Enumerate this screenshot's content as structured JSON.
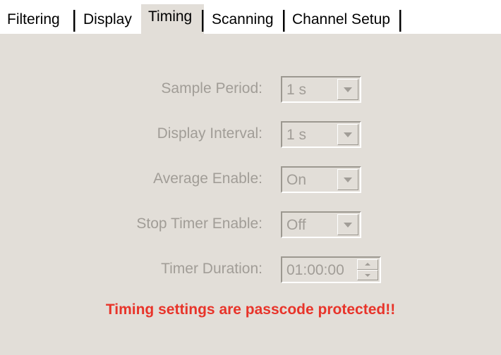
{
  "tabs": [
    {
      "label": "Filtering",
      "active": false
    },
    {
      "label": "Display",
      "active": false
    },
    {
      "label": "Timing",
      "active": true
    },
    {
      "label": "Scanning",
      "active": false
    },
    {
      "label": "Channel Setup",
      "active": false
    }
  ],
  "fields": {
    "sample_period": {
      "label": "Sample Period:",
      "value": "1 s",
      "enabled": false
    },
    "display_interval": {
      "label": "Display Interval:",
      "value": "1 s",
      "enabled": false
    },
    "average_enable": {
      "label": "Average Enable:",
      "value": "On",
      "enabled": false
    },
    "stop_timer_enable": {
      "label": "Stop Timer Enable:",
      "value": "Off",
      "enabled": false
    },
    "timer_duration": {
      "label": "Timer Duration:",
      "value": "01:00:00",
      "enabled": false
    }
  },
  "warning": {
    "text": "Timing settings are passcode protected!!"
  },
  "colors": {
    "panel_bg": "#e2ded8",
    "disabled_text": "#a19d97",
    "warning_text": "#e8342a"
  },
  "icons": {
    "combo_button": "chevron-down-icon",
    "spin_up": "chevron-up-icon",
    "spin_down": "chevron-down-icon"
  }
}
